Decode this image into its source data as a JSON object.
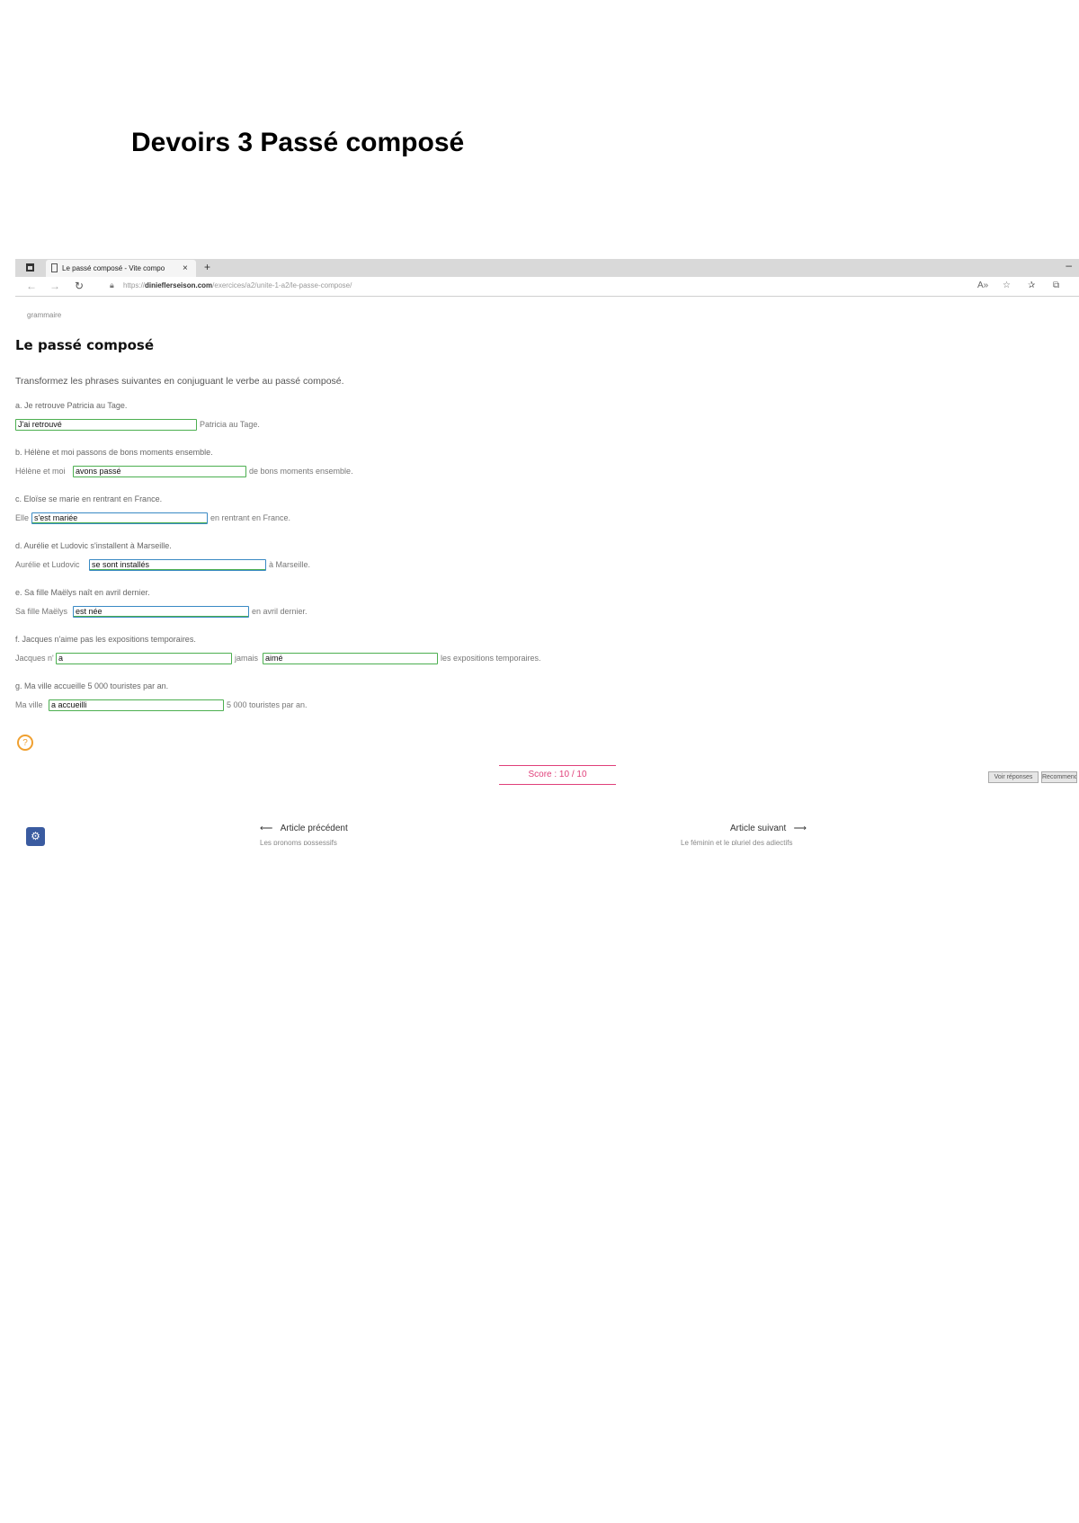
{
  "document": {
    "title": "Devoirs 3 Passé composé"
  },
  "browser": {
    "tab_title": "Le passé composé - Vite compo",
    "tab_close": "×",
    "new_tab": "+",
    "minimize": "–",
    "back": "←",
    "forward": "→",
    "reload": "↻",
    "url_prefix": "https://",
    "url_domain": "dinieflerseison.com",
    "url_path": "/exercices/a2/unite-1-a2/le-passe-compose/",
    "toolbar_icons": [
      "read-aloud-icon",
      "favorite-icon",
      "favorites-bar-icon",
      "collections-icon"
    ]
  },
  "page": {
    "breadcrumb": "grammaire",
    "title": "Le passé composé",
    "instructions": "Transformez les phrases suivantes en conjuguant le verbe au passé composé.",
    "questions": [
      {
        "prompt": "a. Je retrouve Patricia au Tage.",
        "parts": [
          "J'ai retrouvé",
          "Patricia au Tage."
        ]
      },
      {
        "prompt": "b. Hélène et moi passons de bons moments ensemble.",
        "parts": [
          "Hélène et moi",
          "avons passé",
          "de bons moments ensemble."
        ]
      },
      {
        "prompt": "c. Eloïse se marie en rentrant en France.",
        "parts": [
          "Elle",
          "s'est mariée",
          "en rentrant en France."
        ]
      },
      {
        "prompt": "d. Aurélie et Ludovic s'installent à Marseille.",
        "parts": [
          "Aurélie et Ludovic",
          "se sont installés",
          "à Marseille."
        ]
      },
      {
        "prompt": "e. Sa fille Maëlys naît en avril dernier.",
        "parts": [
          "Sa fille Maëlys",
          "est née",
          "en avril dernier."
        ]
      },
      {
        "prompt": "f. Jacques n'aime pas les expositions temporaires.",
        "parts": [
          "Jacques n'",
          "a",
          "jamais",
          "aimé",
          "les expositions temporaires."
        ]
      },
      {
        "prompt": "g. Ma ville accueille 5 000 touristes par an.",
        "parts": [
          "Ma ville",
          "a accueilli",
          "5 000 touristes par an."
        ]
      }
    ],
    "hint_icon": "lightbulb-icon",
    "score": "Score : 10 / 10",
    "buttons": {
      "show_answers": "Voir réponses",
      "restart": "Recommencer"
    },
    "settings_icon": "gear-icon",
    "nav": {
      "prev_label": "Article précédent",
      "prev_sub": "Les pronoms possessifs",
      "next_label": "Article suivant",
      "next_sub": "Le féminin et le pluriel des adjectifs"
    }
  },
  "colors": {
    "input_border": "#4caf50",
    "score_accent": "#e0407a",
    "hint_accent": "#f0a030"
  }
}
